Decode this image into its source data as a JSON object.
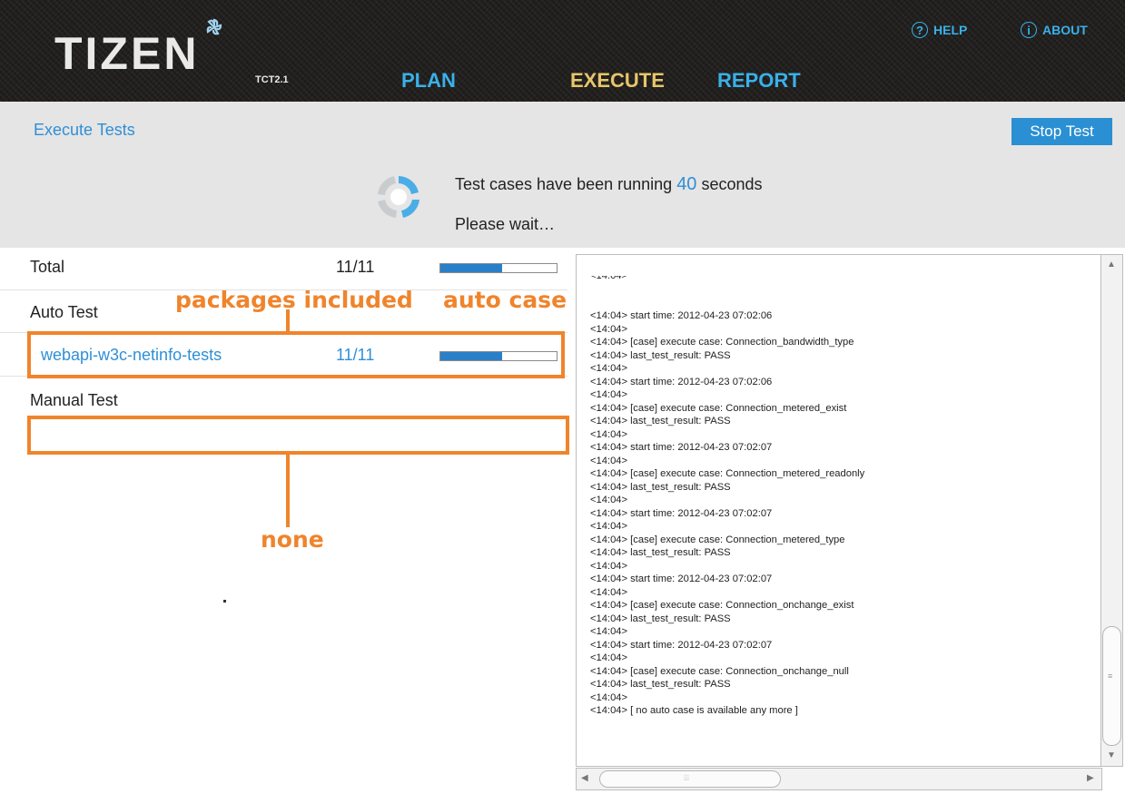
{
  "header": {
    "logo": "TIZEN",
    "version": "TCT2.1",
    "nav": [
      {
        "label": "PLAN"
      },
      {
        "label": "EXECUTE",
        "active": true
      },
      {
        "label": "REPORT"
      }
    ],
    "help": {
      "icon": "?",
      "label": "HELP"
    },
    "about": {
      "icon": "i",
      "label": "ABOUT"
    }
  },
  "status": {
    "title": "Execute Tests",
    "stop_button": "Stop Test",
    "running_prefix": "Test cases have been running",
    "running_seconds": "40",
    "running_suffix": "seconds",
    "wait": "Please wait…"
  },
  "summary": {
    "total": {
      "label": "Total",
      "count": "11/11",
      "progress": 0.53
    },
    "auto_label": "Auto Test",
    "packages": [
      {
        "name": "webapi-w3c-netinfo-tests",
        "count": "11/11",
        "progress": 0.53
      }
    ],
    "manual_label": "Manual Test"
  },
  "annotations": {
    "packages": "packages included",
    "auto": "auto case",
    "none": "none"
  },
  "log_lines": [
    "<14:04> start time: 2012-04-23 07:02:06",
    "<14:04>",
    "<14:04> [case] execute case: Connection_bandwidth_type",
    "<14:04> last_test_result: PASS",
    "<14:04>",
    "<14:04> start time: 2012-04-23 07:02:06",
    "<14:04>",
    "<14:04> [case] execute case: Connection_metered_exist",
    "<14:04> last_test_result: PASS",
    "<14:04>",
    "<14:04> start time: 2012-04-23 07:02:07",
    "<14:04>",
    "<14:04> [case] execute case: Connection_metered_readonly",
    "<14:04> last_test_result: PASS",
    "<14:04>",
    "<14:04> start time: 2012-04-23 07:02:07",
    "<14:04>",
    "<14:04> [case] execute case: Connection_metered_type",
    "<14:04> last_test_result: PASS",
    "<14:04>",
    "<14:04> start time: 2012-04-23 07:02:07",
    "<14:04>",
    "<14:04> [case] execute case: Connection_onchange_exist",
    "<14:04> last_test_result: PASS",
    "<14:04>",
    "<14:04> start time: 2012-04-23 07:02:07",
    "<14:04>",
    "<14:04> [case] execute case: Connection_onchange_null",
    "<14:04> last_test_result: PASS",
    "<14:04>",
    "<14:04> [ no auto case is available any more ]"
  ]
}
